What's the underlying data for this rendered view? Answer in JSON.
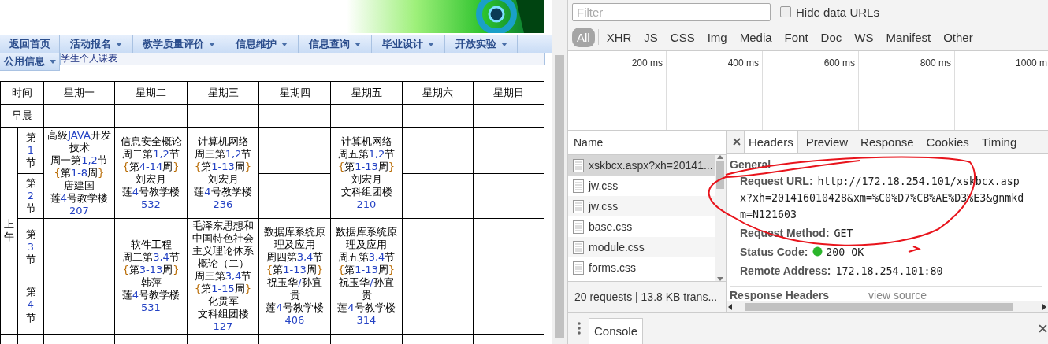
{
  "page": {
    "nav_menu": [
      {
        "label": "返回首页",
        "has_dropdown": false
      },
      {
        "label": "活动报名",
        "has_dropdown": true
      },
      {
        "label": "教学质量评价",
        "has_dropdown": true
      },
      {
        "label": "信息维护",
        "has_dropdown": true
      },
      {
        "label": "信息查询",
        "has_dropdown": true
      },
      {
        "label": "毕业设计",
        "has_dropdown": true
      },
      {
        "label": "开放实验",
        "has_dropdown": true
      }
    ],
    "second_menu": {
      "label": "公用信息",
      "has_dropdown": true
    },
    "breadcrumb": "学生个人课表",
    "timetable": {
      "columns": [
        "时间",
        "星期一",
        "星期二",
        "星期三",
        "星期四",
        "星期五",
        "星期六",
        "星期日"
      ],
      "morning_label": "早晨",
      "session_label": "上午",
      "periods": [
        {
          "label": "第1节",
          "cells": [
            {
              "kind": "course",
              "spans_two_periods": true,
              "lines": [
                "高级JAVA开发技术",
                "周一第1,2节",
                "{第1-8周}",
                "唐建国",
                "莲4号教学楼",
                "207"
              ]
            },
            {
              "kind": "course",
              "spans_two_periods": true,
              "lines": [
                "信息安全概论",
                "周二第1,2节",
                "{第4-14周}",
                "刘宏月",
                "莲4号教学楼",
                "532"
              ]
            },
            {
              "kind": "course",
              "spans_two_periods": true,
              "lines": [
                "计算机网络",
                "周三第1,2节",
                "{第1-13周}",
                "刘宏月",
                "莲4号教学楼",
                "236"
              ]
            },
            {
              "kind": "empty"
            },
            {
              "kind": "course",
              "spans_two_periods": true,
              "lines": [
                "计算机网络",
                "周五第1,2节",
                "{第1-13周}",
                "刘宏月",
                "文科组团楼",
                "210"
              ]
            },
            {
              "kind": "empty"
            },
            {
              "kind": "empty"
            }
          ]
        },
        {
          "label": "第2节",
          "cells": [
            {
              "kind": "covered"
            },
            {
              "kind": "covered"
            },
            {
              "kind": "covered"
            },
            {
              "kind": "empty"
            },
            {
              "kind": "covered"
            },
            {
              "kind": "empty"
            },
            {
              "kind": "empty"
            }
          ]
        },
        {
          "label": "第3节",
          "cells": [
            {
              "kind": "empty"
            },
            {
              "kind": "course",
              "spans_two_periods": true,
              "lines": [
                "软件工程",
                "周二第3,4节",
                "{第3-13周}",
                "韩萍",
                "莲4号教学楼",
                "531"
              ]
            },
            {
              "kind": "course",
              "spans_two_periods": true,
              "lines": [
                "毛泽东思想和中国特色社会主义理论体系概论（二）",
                "周三第3,4节",
                "{第1-15周}",
                "化贯军",
                "文科组团楼",
                "127"
              ]
            },
            {
              "kind": "course",
              "spans_two_periods": true,
              "lines": [
                "数据库系统原理及应用",
                "周四第3,4节",
                "{第1-13周}",
                "祝玉华/孙宜贵",
                "莲4号教学楼",
                "406"
              ]
            },
            {
              "kind": "course",
              "spans_two_periods": true,
              "lines": [
                "数据库系统原理及应用",
                "周五第3,4节",
                "{第1-13周}",
                "祝玉华/孙宜贵",
                "莲4号教学楼",
                "314"
              ]
            },
            {
              "kind": "empty"
            },
            {
              "kind": "empty"
            }
          ]
        },
        {
          "label": "第4节",
          "cells": [
            {
              "kind": "empty"
            },
            {
              "kind": "covered"
            },
            {
              "kind": "covered"
            },
            {
              "kind": "covered"
            },
            {
              "kind": "covered"
            },
            {
              "kind": "empty"
            },
            {
              "kind": "empty"
            }
          ]
        }
      ]
    }
  },
  "devtools": {
    "filter": {
      "placeholder": "Filter"
    },
    "hide_data_urls": {
      "label": "Hide data URLs",
      "checked": false
    },
    "type_filters": [
      {
        "label": "All",
        "selected": true
      },
      {
        "label": "XHR",
        "selected": false
      },
      {
        "label": "JS",
        "selected": false
      },
      {
        "label": "CSS",
        "selected": false
      },
      {
        "label": "Img",
        "selected": false
      },
      {
        "label": "Media",
        "selected": false
      },
      {
        "label": "Font",
        "selected": false
      },
      {
        "label": "Doc",
        "selected": false
      },
      {
        "label": "WS",
        "selected": false
      },
      {
        "label": "Manifest",
        "selected": false
      },
      {
        "label": "Other",
        "selected": false
      }
    ],
    "timeline_ticks": [
      "200 ms",
      "400 ms",
      "600 ms",
      "800 ms",
      "1000 m"
    ],
    "requests": {
      "header": "Name",
      "items": [
        {
          "name": "xskbcx.aspx?xh=20141...",
          "selected": true
        },
        {
          "name": "jw.css",
          "selected": false
        },
        {
          "name": "jw.css",
          "selected": false
        },
        {
          "name": "base.css",
          "selected": false
        },
        {
          "name": "module.css",
          "selected": false
        },
        {
          "name": "forms.css",
          "selected": false
        }
      ]
    },
    "summary": "20 requests | 13.8 KB trans...",
    "detail_tabs": [
      {
        "label": "Headers",
        "selected": true
      },
      {
        "label": "Preview",
        "selected": false
      },
      {
        "label": "Response",
        "selected": false
      },
      {
        "label": "Cookies",
        "selected": false
      },
      {
        "label": "Timing",
        "selected": false
      }
    ],
    "general": {
      "title": "General",
      "fields": [
        {
          "kind": "url",
          "label": "Request URL:",
          "value": "http://172.18.254.101/xskbcx.aspx?xh=201416010428&xm=%C0%D7%CB%AE%D3%E3&gnmkdm=N121603"
        },
        {
          "kind": "plain",
          "label": "Request Method:",
          "value": "GET"
        },
        {
          "kind": "status",
          "label": "Status Code:",
          "value": "200 OK"
        },
        {
          "kind": "plain",
          "label": "Remote Address:",
          "value": "172.18.254.101:80"
        }
      ]
    },
    "response_headers": {
      "title": "Response Headers",
      "link": "view source"
    },
    "drawer_tabs": [
      "Console"
    ]
  }
}
